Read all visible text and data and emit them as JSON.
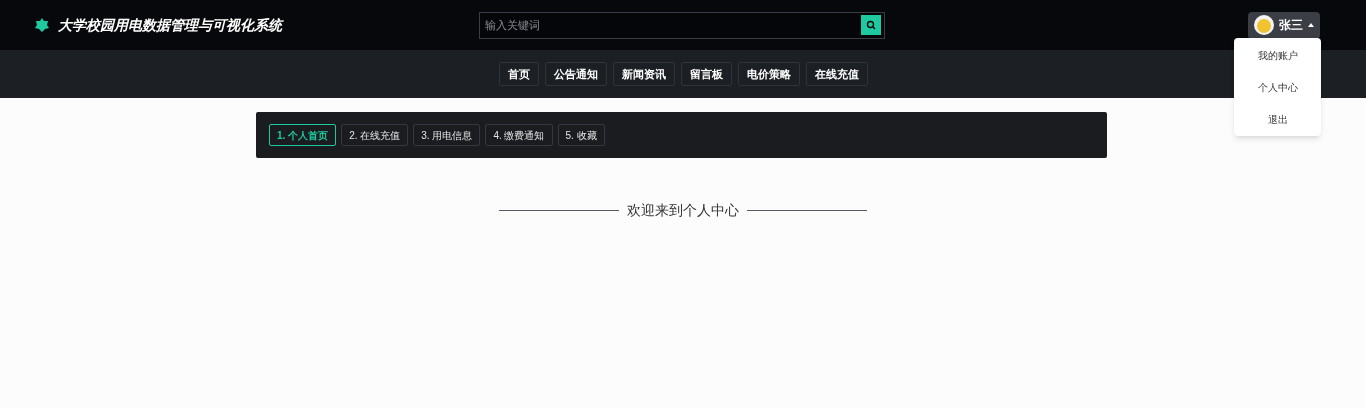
{
  "header": {
    "title": "大学校园用电数据管理与可视化系统",
    "search": {
      "placeholder": "输入关键词"
    },
    "user": {
      "name": "张三",
      "expanded": true,
      "menu": [
        "我的账户",
        "个人中心",
        "退出"
      ]
    }
  },
  "nav": [
    "首页",
    "公告通知",
    "新闻资讯",
    "留言板",
    "电价策略",
    "在线充值"
  ],
  "tabs": [
    {
      "label": "1. 个人首页",
      "selected": true
    },
    {
      "label": "2. 在线充值",
      "selected": false
    },
    {
      "label": "3. 用电信息",
      "selected": false
    },
    {
      "label": "4. 缴费通知",
      "selected": false
    },
    {
      "label": "5. 收藏",
      "selected": false
    }
  ],
  "welcome": "欢迎来到个人中心"
}
